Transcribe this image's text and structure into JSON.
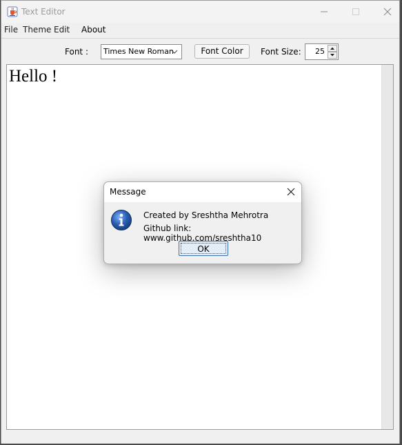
{
  "window": {
    "title": "Text Editor",
    "icon": "java-cup-icon",
    "controls": {
      "minimize": "minimize-icon",
      "maximize": "maximize-icon",
      "close": "close-icon"
    }
  },
  "menu": {
    "items": [
      {
        "label": "File"
      },
      {
        "label": "Theme"
      },
      {
        "label": "Edit"
      },
      {
        "label": "About"
      }
    ]
  },
  "toolbar": {
    "font_label": "Font :",
    "font_value": "Times New Roman",
    "font_color_label": "Font Color",
    "font_size_label": "Font Size:",
    "font_size_value": "25"
  },
  "editor": {
    "content": "Hello !",
    "font_size": 25
  },
  "dialog": {
    "title": "Message",
    "line1": "Created by Sreshtha Mehrotra",
    "line2": "Github link: www.github.com/sreshtha10",
    "ok_label": "OK",
    "icon": "info-icon"
  },
  "colors": {
    "info_blue": "#2a5db0",
    "ok_border": "#3b6fb0"
  }
}
